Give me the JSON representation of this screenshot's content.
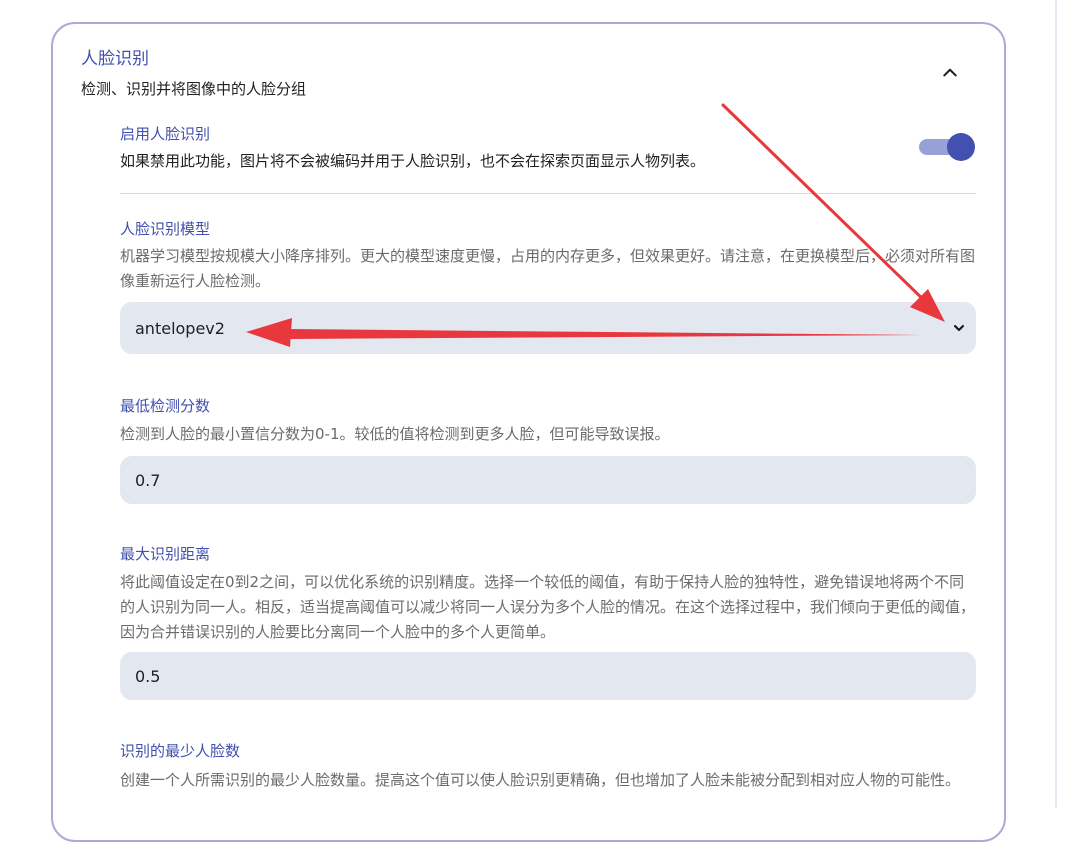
{
  "card": {
    "title": "人脸识别",
    "subtitle": "检测、识别并将图像中的人脸分组"
  },
  "enable": {
    "label": "启用人脸识别",
    "description": "如果禁用此功能，图片将不会被编码并用于人脸识别，也不会在探索页面显示人物列表。",
    "checked": true
  },
  "model": {
    "label": "人脸识别模型",
    "description": "机器学习模型按规模大小降序排列。更大的模型速度更慢，占用的内存更多，但效果更好。请注意，在更换模型后，必须对所有图像重新运行人脸检测。",
    "value": "antelopev2"
  },
  "min_score": {
    "label": "最低检测分数",
    "description": "检测到人脸的最小置信分数为0-1。较低的值将检测到更多人脸，但可能导致误报。",
    "value": "0.7"
  },
  "max_distance": {
    "label": "最大识别距离",
    "description": "将此阈值设定在0到2之间，可以优化系统的识别精度。选择一个较低的阈值，有助于保持人脸的独特性，避免错误地将两个不同的人识别为同一人。相反，适当提高阈值可以减少将同一人误分为多个人脸的情况。在这个选择过程中，我们倾向于更低的阈值，因为合并错误识别的人脸要比分离同一个人脸中的多个人更简单。",
    "value": "0.5"
  },
  "min_faces": {
    "label": "识别的最少人脸数",
    "description": "创建一个人所需识别的最少人脸数量。提高这个值可以使人脸识别更精确，但也增加了人脸未能被分配到相对应人物的可能性。"
  },
  "colors": {
    "accent": "#4250af",
    "annotation_arrow": "#e8383d",
    "field_bg": "#e2e7f0"
  }
}
